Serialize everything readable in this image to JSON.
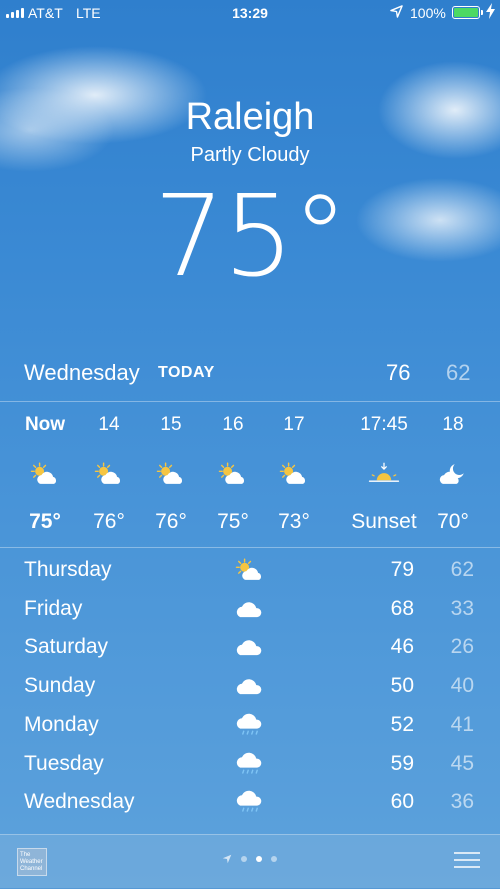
{
  "status_bar": {
    "carrier": "AT&T",
    "network": "LTE",
    "time": "13:29",
    "battery_percent": "100%",
    "battery_level": 1.0,
    "charging": true,
    "battery_color": "#4cd964"
  },
  "header": {
    "city": "Raleigh",
    "condition": "Partly Cloudy",
    "temperature": "75°"
  },
  "today": {
    "day": "Wednesday",
    "tag": "TODAY",
    "high": "76",
    "low": "62"
  },
  "hourly": [
    {
      "label": "Now",
      "icon": "partly-cloudy-icon",
      "temp": "75°"
    },
    {
      "label": "14",
      "icon": "partly-cloudy-icon",
      "temp": "76°"
    },
    {
      "label": "15",
      "icon": "partly-cloudy-icon",
      "temp": "76°"
    },
    {
      "label": "16",
      "icon": "partly-cloudy-icon",
      "temp": "75°"
    },
    {
      "label": "17",
      "icon": "partly-cloudy-icon",
      "temp": "73°"
    },
    {
      "label": "17:45",
      "icon": "sunset-icon",
      "temp": "Sunset"
    },
    {
      "label": "18",
      "icon": "partly-cloudy-night-icon",
      "temp": "70°"
    }
  ],
  "daily": [
    {
      "day": "Thursday",
      "icon": "partly-cloudy-icon",
      "high": "79",
      "low": "62"
    },
    {
      "day": "Friday",
      "icon": "cloud-icon",
      "high": "68",
      "low": "33"
    },
    {
      "day": "Saturday",
      "icon": "cloud-icon",
      "high": "46",
      "low": "26"
    },
    {
      "day": "Sunday",
      "icon": "cloud-icon",
      "high": "50",
      "low": "40"
    },
    {
      "day": "Monday",
      "icon": "rain-icon",
      "high": "52",
      "low": "41"
    },
    {
      "day": "Tuesday",
      "icon": "rain-icon",
      "high": "59",
      "low": "45"
    },
    {
      "day": "Wednesday",
      "icon": "rain-icon",
      "high": "60",
      "low": "36"
    }
  ],
  "toolbar": {
    "logo_text": "The Weather Channel",
    "page_count": 3,
    "active_page": 1
  }
}
